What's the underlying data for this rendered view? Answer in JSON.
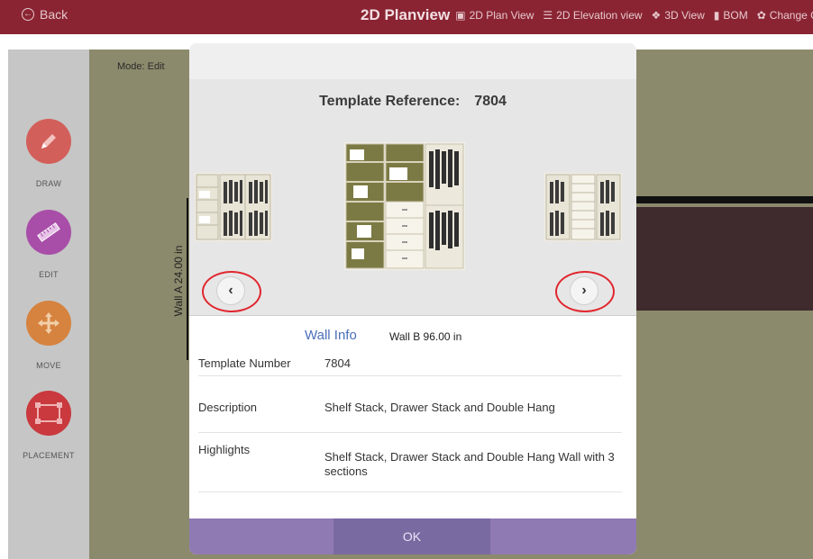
{
  "topbar": {
    "back_label": "Back",
    "title": "2D Planview",
    "nav": [
      {
        "label": "2D Plan View",
        "icon": "plan-icon"
      },
      {
        "label": "2D Elevation view",
        "icon": "list-icon"
      },
      {
        "label": "3D View",
        "icon": "cube-icon"
      },
      {
        "label": "BOM",
        "icon": "document-icon"
      },
      {
        "label": "Change Colo",
        "icon": "palette-icon"
      }
    ]
  },
  "canvas": {
    "mode_label": "Mode: Edit",
    "wall_label": "Wall A 24.00 in"
  },
  "tools": [
    {
      "label": "DRAW",
      "icon": "pencil-icon",
      "color": "#d35f5a"
    },
    {
      "label": "EDIT",
      "icon": "ruler-icon",
      "color": "#a84ea8"
    },
    {
      "label": "MOVE",
      "icon": "move-arrows-icon",
      "color": "#d6833f"
    },
    {
      "label": "PLACEMENT",
      "icon": "placement-icon",
      "color": "#c9393d"
    }
  ],
  "modal": {
    "template_ref_label": "Template Reference:",
    "template_ref_value": "7804",
    "wall_info_label": "Wall Info",
    "wall_info_value": "Wall B 96.00 in",
    "rows": [
      {
        "label": "Template Number",
        "value": "7804"
      },
      {
        "label": "Description",
        "value": "Shelf Stack, Drawer Stack and Double Hang"
      },
      {
        "label": "Highlights",
        "value": "Shelf Stack, Drawer Stack and Double Hang Wall with 3 sections"
      }
    ],
    "ok_label": "OK"
  }
}
